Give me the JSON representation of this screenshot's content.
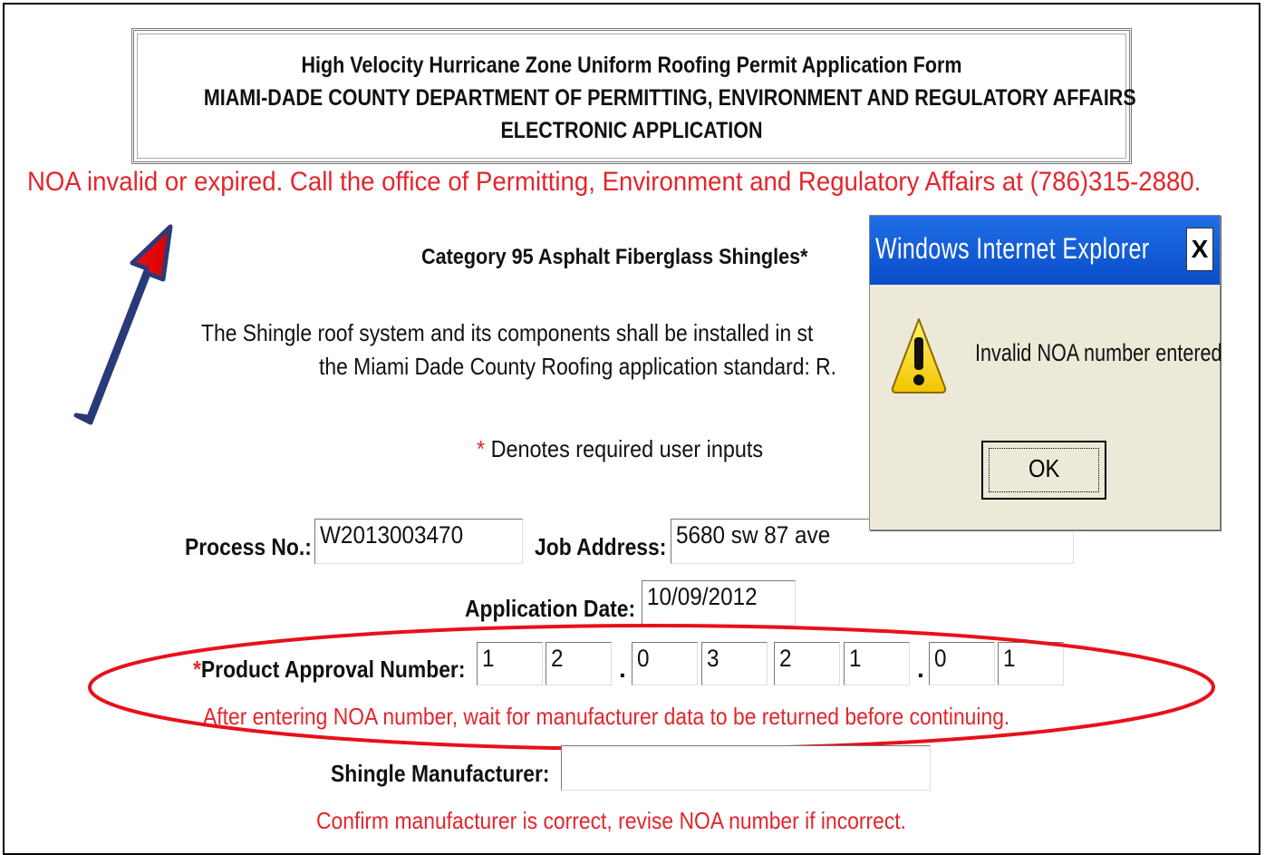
{
  "header": {
    "line1": "High Velocity Hurricane Zone Uniform Roofing Permit Application Form",
    "line2": "MIAMI-DADE COUNTY DEPARTMENT OF PERMITTING, ENVIRONMENT AND REGULATORY AFFAIRS",
    "line3": "ELECTRONIC APPLICATION"
  },
  "error_banner": "NOA invalid or expired. Call the office of Permitting, Environment and Regulatory Affairs at (786)315-2880.",
  "category": "Category 95 Asphalt Fiberglass Shingles*",
  "install_text": {
    "line1": "The Shingle roof system and its components shall be installed in st",
    "line2": "the Miami Dade County Roofing application standard: R."
  },
  "required_note": {
    "star": "*",
    "text": " Denotes required user inputs"
  },
  "form": {
    "process_label": "Process No.:",
    "process_value": "W2013003470",
    "job_address_label": "Job Address:",
    "job_address_value": "5680 sw 87 ave",
    "application_date_label": "Application Date:",
    "application_date_value": "10/09/2012",
    "product_approval_star": "*",
    "product_approval_label": "Product Approval Number:",
    "noa_digits": [
      "1",
      "2",
      "0",
      "3",
      "2",
      "1",
      "0",
      "1"
    ],
    "noa_separator": ".",
    "noa_hint": "After entering NOA number, wait for manufacturer data to be returned before continuing.",
    "manufacturer_label": "Shingle Manufacturer:",
    "manufacturer_value": "",
    "manufacturer_hint": "Confirm manufacturer is correct, revise NOA number if incorrect."
  },
  "dialog": {
    "title": "Windows Internet Explorer",
    "close_label": "X",
    "message": "Invalid NOA number entered",
    "ok_label": "OK",
    "icon": "warning-icon"
  },
  "colors": {
    "error_red": "#e3252c",
    "annotation_red": "#e8101a",
    "dialog_title_blue": "#0a4cc9",
    "dialog_bg": "#ece9d8"
  }
}
